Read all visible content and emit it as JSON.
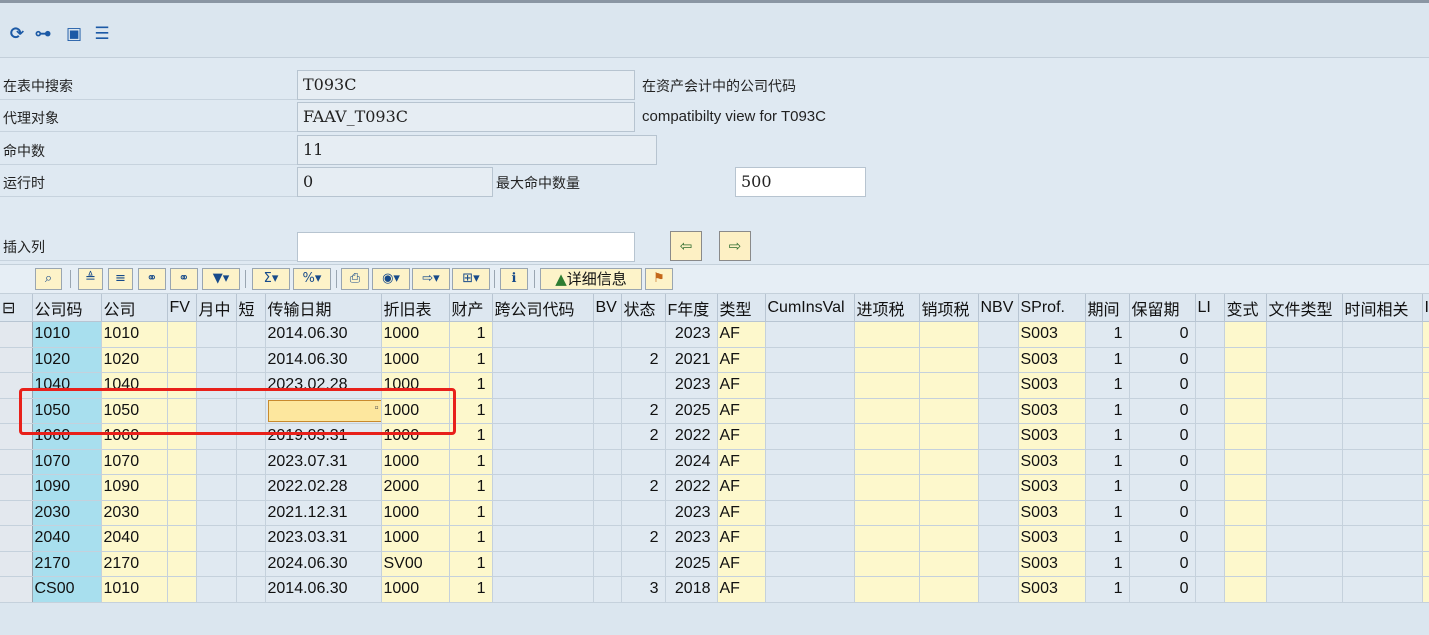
{
  "app_toolbar": {
    "icons": [
      "refresh-icon",
      "tree-icon",
      "expand-icon",
      "list-icon"
    ]
  },
  "form": {
    "search_table_label": "在表中搜索",
    "search_table_value": "T093C",
    "search_table_desc": "在资产会计中的公司代码",
    "proxy_object_label": "代理对象",
    "proxy_object_value": "FAAV_T093C",
    "proxy_object_desc": "compatibilty view for T093C",
    "hits_label": "命中数",
    "hits_value": "11",
    "runtime_label": "运行时",
    "runtime_value": "0",
    "max_hits_label": "最大命中数量",
    "max_hits_value": "500",
    "insert_column_label": "插入列",
    "insert_column_value": ""
  },
  "alv_toolbar": {
    "details_label": "详细信息"
  },
  "grid": {
    "columns": [
      "公司码",
      "公司",
      "FV",
      "月中",
      "短",
      "传输日期",
      "折旧表",
      "财产",
      "跨公司代码",
      "BV",
      "状态",
      "F年度",
      "类型",
      "CumInsVal",
      "进项税",
      "销项税",
      "NBV",
      "SProf.",
      "期间",
      "保留期",
      "LI",
      "变式",
      "文件类型",
      "时间相关",
      "I"
    ],
    "rows": [
      [
        "1010",
        "1010",
        "",
        "",
        "",
        "2014.06.30",
        "1000",
        "1",
        "",
        "",
        "",
        "2023",
        "AF",
        "",
        "",
        "",
        "",
        "S003",
        "1",
        "0",
        "",
        "",
        "",
        "",
        ""
      ],
      [
        "1020",
        "1020",
        "",
        "",
        "",
        "2014.06.30",
        "1000",
        "1",
        "",
        "",
        "2",
        "2021",
        "AF",
        "",
        "",
        "",
        "",
        "S003",
        "1",
        "0",
        "",
        "",
        "",
        "",
        ""
      ],
      [
        "1040",
        "1040",
        "",
        "",
        "",
        "2023.02.28",
        "1000",
        "1",
        "",
        "",
        "",
        "2023",
        "AF",
        "",
        "",
        "",
        "",
        "S003",
        "1",
        "0",
        "",
        "",
        "",
        "",
        ""
      ],
      [
        "1050",
        "1050",
        "",
        "",
        "",
        "",
        "1000",
        "1",
        "",
        "",
        "2",
        "2025",
        "AF",
        "",
        "",
        "",
        "",
        "S003",
        "1",
        "0",
        "",
        "",
        "",
        "",
        ""
      ],
      [
        "1060",
        "1060",
        "",
        "",
        "",
        "2019.03.31",
        "1000",
        "1",
        "",
        "",
        "2",
        "2022",
        "AF",
        "",
        "",
        "",
        "",
        "S003",
        "1",
        "0",
        "",
        "",
        "",
        "",
        ""
      ],
      [
        "1070",
        "1070",
        "",
        "",
        "",
        "2023.07.31",
        "1000",
        "1",
        "",
        "",
        "",
        "2024",
        "AF",
        "",
        "",
        "",
        "",
        "S003",
        "1",
        "0",
        "",
        "",
        "",
        "",
        ""
      ],
      [
        "1090",
        "1090",
        "",
        "",
        "",
        "2022.02.28",
        "2000",
        "1",
        "",
        "",
        "2",
        "2022",
        "AF",
        "",
        "",
        "",
        "",
        "S003",
        "1",
        "0",
        "",
        "",
        "",
        "",
        ""
      ],
      [
        "2030",
        "2030",
        "",
        "",
        "",
        "2021.12.31",
        "1000",
        "1",
        "",
        "",
        "",
        "2023",
        "AF",
        "",
        "",
        "",
        "",
        "S003",
        "1",
        "0",
        "",
        "",
        "",
        "",
        ""
      ],
      [
        "2040",
        "2040",
        "",
        "",
        "",
        "2023.03.31",
        "1000",
        "1",
        "",
        "",
        "2",
        "2023",
        "AF",
        "",
        "",
        "",
        "",
        "S003",
        "1",
        "0",
        "",
        "",
        "",
        "",
        ""
      ],
      [
        "2170",
        "2170",
        "",
        "",
        "",
        "2024.06.30",
        "SV00",
        "1",
        "",
        "",
        "",
        "2025",
        "AF",
        "",
        "",
        "",
        "",
        "S003",
        "1",
        "0",
        "",
        "",
        "",
        "",
        ""
      ],
      [
        "CS00",
        "1010",
        "",
        "",
        "",
        "2014.06.30",
        "1000",
        "1",
        "",
        "",
        "3",
        "2018",
        "AF",
        "",
        "",
        "",
        "",
        "S003",
        "1",
        "0",
        "",
        "",
        "",
        "",
        ""
      ]
    ]
  },
  "colors": {
    "key_column": "#a8dfee",
    "editable_column": "#fdf8cc",
    "highlight_box": "#e8201a"
  }
}
